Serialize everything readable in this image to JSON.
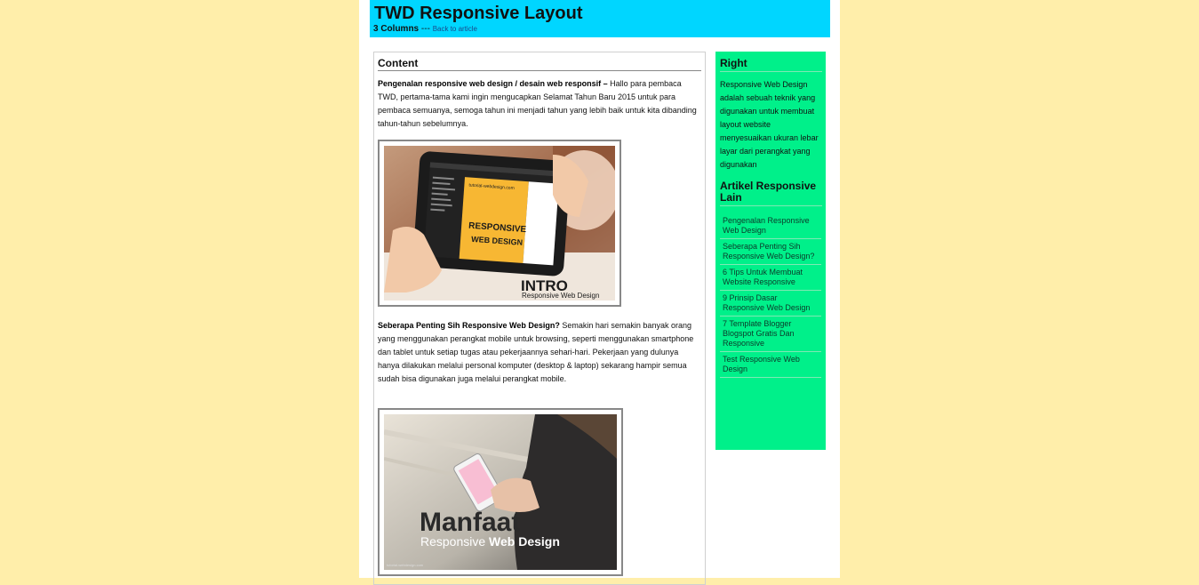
{
  "header": {
    "title": "TWD Responsive Layout",
    "columns_label": "3 Columns",
    "separator": "---",
    "back_link": "Back to article"
  },
  "content": {
    "heading": "Content",
    "para1_bold": "Pengenalan responsive web design / desain web responsif –",
    "para1_text": " Hallo para pembaca TWD, pertama-tama kami ingin mengucapkan Selamat Tahun Baru 2015 untuk para pembaca semuanya, semoga tahun ini menjadi tahun yang lebih baik untuk kita dibanding tahun-tahun sebelumnya.",
    "image1": {
      "site": "tutorial-webdesign.com",
      "screen_title_1": "RESPONSIVE",
      "screen_title_2": "WEB DESIGN",
      "caption_1": "INTRO",
      "caption_2": "Responsive Web Design"
    },
    "para2_bold": "Seberapa Penting Sih Responsive Web Design?",
    "para2_text": " Semakin hari semakin banyak orang yang menggunakan perangkat mobile untuk browsing, seperti menggunakan smartphone dan tablet untuk setiap tugas atau pekerjaannya sehari-hari. Pekerjaan yang dulunya hanya dilakukan melalui personal komputer (desktop & laptop) sekarang hampir semua sudah bisa digunakan juga melalui perangkat mobile.",
    "image2": {
      "caption_1": "Manfaat",
      "caption_2a": "Responsive ",
      "caption_2b": "Web Design",
      "watermark": "tutorial-webdesign.com"
    }
  },
  "sidebar": {
    "heading": "Right",
    "description": "Responsive Web Design adalah sebuah teknik yang digunakan untuk membuat layout website menyesuaikan ukuran lebar layar dari perangkat yang digunakan",
    "links_heading": "Artikel Responsive Lain",
    "links": [
      "Pengenalan Responsive Web Design",
      "Seberapa Penting Sih Responsive Web Design?",
      "6 Tips Untuk Membuat Website Responsive",
      "9 Prinsip Dasar Responsive Web Design",
      "7 Template Blogger Blogspot Gratis Dan Responsive",
      "Test Responsive Web Design"
    ]
  },
  "colors": {
    "page_bg": "#ffeeaa",
    "header_bg": "#00d6ff",
    "sidebar_bg": "#00f08a"
  }
}
